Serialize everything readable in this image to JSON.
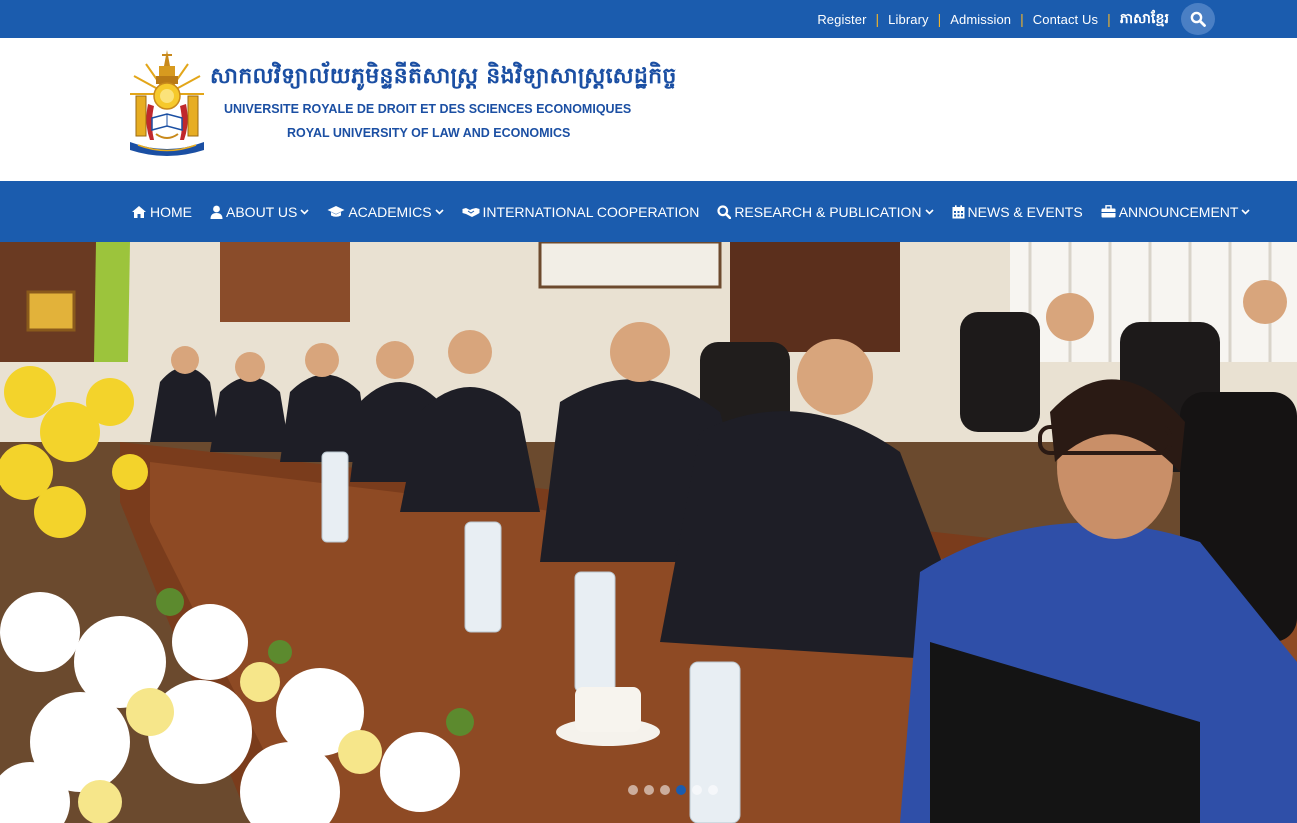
{
  "topbar": {
    "links": [
      "Register",
      "Library",
      "Admission",
      "Contact Us"
    ],
    "language": "ភាសាខ្មែរ",
    "search_icon": "search-icon"
  },
  "header": {
    "khmer_name": "សាកលវិទ្យាល័យភូមិន្ទនីតិសាស្ត្រ និងវិទ្យាសាស្ត្រសេដ្ឋកិច្ច",
    "french_name": "UNIVERSITE ROYALE DE DROIT ET DES SCIENCES ECONOMIQUES",
    "english_name": "ROYAL UNIVERSITY OF LAW AND ECONOMICS"
  },
  "nav": {
    "items": [
      {
        "label": "HOME",
        "icon": "home-icon",
        "dropdown": false
      },
      {
        "label": "ABOUT US",
        "icon": "user-icon",
        "dropdown": true
      },
      {
        "label": "ACADEMICS",
        "icon": "graduation-cap-icon",
        "dropdown": true
      },
      {
        "label": "INTERNATIONAL COOPERATION",
        "icon": "handshake-icon",
        "dropdown": false
      },
      {
        "label": "RESEARCH & PUBLICATION",
        "icon": "search-icon",
        "dropdown": true
      },
      {
        "label": "NEWS & EVENTS",
        "icon": "calendar-icon",
        "dropdown": false
      },
      {
        "label": "ANNOUNCEMENT",
        "icon": "briefcase-icon",
        "dropdown": true
      }
    ]
  },
  "slider": {
    "slide_count": 6,
    "active_index": 3
  },
  "colors": {
    "brand_blue": "#1b5cae",
    "separator_gold": "#f0b32a",
    "logo_text_blue": "#1b4fa3"
  }
}
